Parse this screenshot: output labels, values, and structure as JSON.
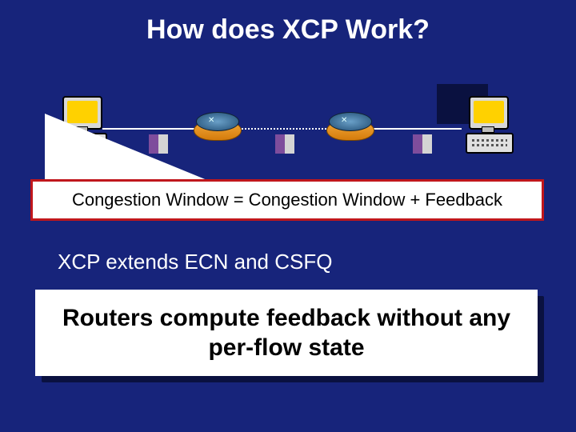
{
  "title": "How does XCP Work?",
  "formula": "Congestion Window = Congestion Window + Feedback",
  "subline": "XCP extends ECN and CSFQ",
  "statement": "Routers compute feedback without any per-flow state"
}
